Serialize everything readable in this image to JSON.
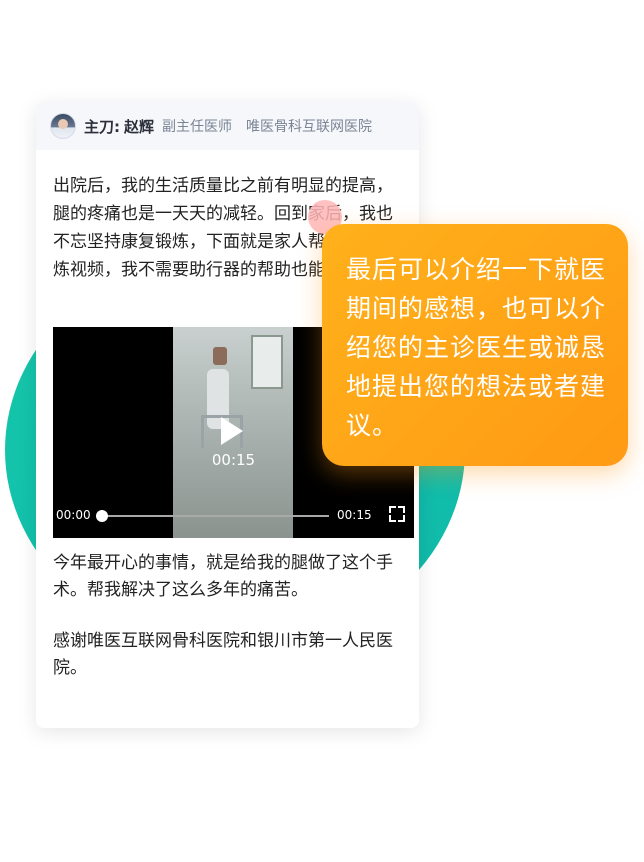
{
  "header": {
    "role_label": "主刀:",
    "doctor_name": "赵辉",
    "doctor_title": "副主任医师",
    "hospital": "唯医骨科互联网医院"
  },
  "post": {
    "paragraph_1": "出院后，我的生活质量比之前有明显的提高，腿的疼痛也是一天天的减轻。回到家后，我也不忘坚持康复锻炼，下面就是家人帮我拍的锻炼视频，我不需要助行器的帮助也能走路",
    "paragraph_2": "今年最开心的事情，就是给我的腿做了这个手术。帮我解决了这么多年的痛苦。",
    "paragraph_3": "感谢唯医互联网骨科医院和银川市第一人民医院。"
  },
  "video": {
    "center_duration": "00:15",
    "current_time": "00:00",
    "total_time": "00:15",
    "progress_fraction": 0.0
  },
  "tip_bubble": {
    "text": "最后可以介绍一下就医期间的感想，也可以介绍您的主诊医生或诚恳地提出您的想法或者建议。"
  },
  "colors": {
    "teal_accent": "#17c6a6",
    "orange_bubble": "#ffa516"
  }
}
